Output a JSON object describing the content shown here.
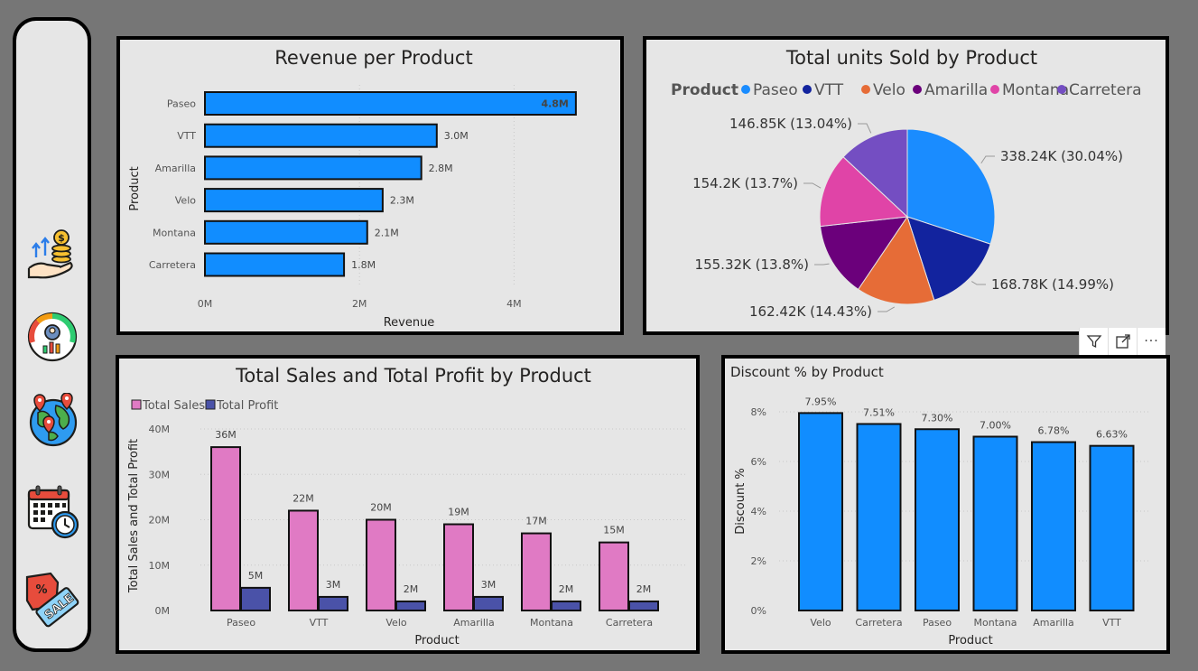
{
  "nav": {
    "items": [
      {
        "icon": "revenue-money-hand-icon"
      },
      {
        "icon": "performance-gauge-icon"
      },
      {
        "icon": "globe-location-icon"
      },
      {
        "icon": "calendar-clock-icon"
      },
      {
        "icon": "sale-tag-icon"
      }
    ]
  },
  "colors": {
    "blue": "#118dff",
    "pink": "#e07ac4",
    "navy": "#4a52a8",
    "pie": [
      "#1a8cff",
      "#12239e",
      "#e66c37",
      "#6b007b",
      "#e044a7",
      "#744ec2"
    ]
  },
  "charts": [
    {
      "id": "revenue",
      "type": "bar",
      "title": "Revenue per Product",
      "xlabel": "Revenue",
      "ylabel": "Product",
      "categories": [
        "Paseo",
        "VTT",
        "Amarilla",
        "Velo",
        "Montana",
        "Carretera"
      ],
      "values": [
        4.8,
        3.0,
        2.8,
        2.3,
        2.1,
        1.8
      ],
      "value_labels": [
        "4.8M",
        "3.0M",
        "2.8M",
        "2.3M",
        "2.1M",
        "1.8M"
      ],
      "ticks": [
        "0M",
        "2M",
        "4M"
      ],
      "xlim": [
        0,
        5
      ]
    },
    {
      "id": "units",
      "type": "pie",
      "title": "Total units Sold by Product",
      "legend_title": "Product",
      "labels": [
        "Paseo",
        "VTT",
        "Velo",
        "Amarilla",
        "Montana",
        "Carretera"
      ],
      "values": [
        338.24,
        168.78,
        162.42,
        155.32,
        154.2,
        146.85
      ],
      "slice_labels": [
        "338.24K (30.04%)",
        "168.78K (14.99%)",
        "162.42K (14.43%)",
        "155.32K (13.8%)",
        "154.2K (13.7%)",
        "146.85K (13.04%)"
      ]
    },
    {
      "id": "salesprofit",
      "type": "bar",
      "title": "Total Sales and Total Profit by Product",
      "xlabel": "Product",
      "ylabel": "Total Sales and Total Profit",
      "categories": [
        "Paseo",
        "VTT",
        "Velo",
        "Amarilla",
        "Montana",
        "Carretera"
      ],
      "series": [
        {
          "name": "Total Sales",
          "values": [
            36,
            22,
            20,
            19,
            17,
            15
          ],
          "labels": [
            "36M",
            "22M",
            "20M",
            "19M",
            "17M",
            "15M"
          ]
        },
        {
          "name": "Total Profit",
          "values": [
            5,
            3,
            2,
            3,
            2,
            2
          ],
          "labels": [
            "5M",
            "3M",
            "2M",
            "3M",
            "2M",
            "2M"
          ]
        }
      ],
      "ticks": [
        "0M",
        "10M",
        "20M",
        "30M",
        "40M"
      ],
      "ylim": [
        0,
        40
      ]
    },
    {
      "id": "discount",
      "type": "bar",
      "title": "Discount % by Product",
      "xlabel": "Product",
      "ylabel": "Discount %",
      "categories": [
        "Velo",
        "Carretera",
        "Paseo",
        "Montana",
        "Amarilla",
        "VTT"
      ],
      "values": [
        7.95,
        7.51,
        7.3,
        7.0,
        6.78,
        6.63
      ],
      "value_labels": [
        "7.95%",
        "7.51%",
        "7.30%",
        "7.00%",
        "6.78%",
        "6.63%"
      ],
      "ticks": [
        "0%",
        "2%",
        "4%",
        "6%",
        "8%"
      ],
      "ylim": [
        0,
        8
      ]
    }
  ],
  "toolbar": {
    "items": [
      "filter-icon",
      "focus-mode-icon",
      "more-options-icon"
    ],
    "more_label": "···"
  }
}
